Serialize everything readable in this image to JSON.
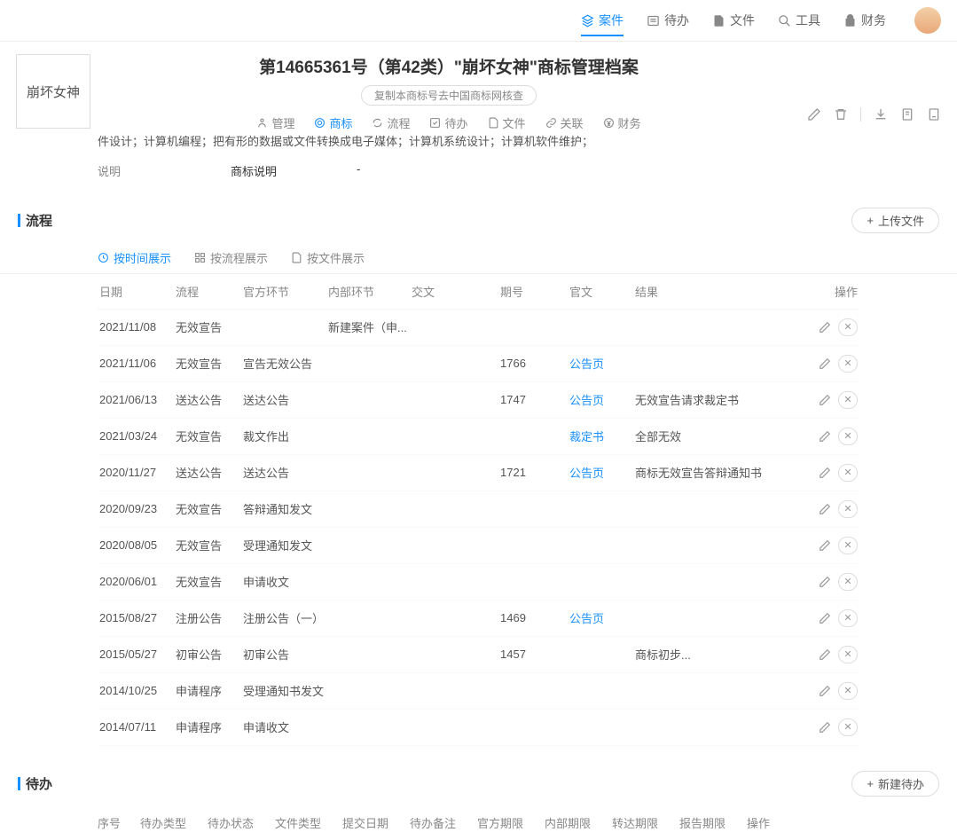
{
  "topnav": {
    "case": "案件",
    "todo": "待办",
    "file": "文件",
    "tool": "工具",
    "finance": "财务"
  },
  "brandText": "崩坏女神",
  "pageTitle": "第14665361号（第42类）\"崩坏女神\"商标管理档案",
  "copyLink": "复制本商标号去中国商标网核查",
  "subnav": {
    "manage": "管理",
    "trademark": "商标",
    "process": "流程",
    "todo": "待办",
    "file": "文件",
    "relation": "关联",
    "finance": "财务"
  },
  "descLine": "件设计；计算机编程；把有形的数据或文件转换成电子媒体；计算机系统设计；计算机软件维护；",
  "descLabel": "说明",
  "descField": "商标说明",
  "descDash": "-",
  "sectionProcess": "流程",
  "uploadBtn": "上传文件",
  "viewtabs": {
    "byTime": "按时间展示",
    "byProcess": "按流程展示",
    "byFile": "按文件展示"
  },
  "cols": {
    "date": "日期",
    "process": "流程",
    "official": "官方环节",
    "internal": "内部环节",
    "exchange": "交文",
    "issue": "期号",
    "officialDoc": "官文",
    "result": "结果",
    "ops": "操作"
  },
  "rows": [
    {
      "date": "2021/11/08",
      "process": "无效宣告",
      "official": "",
      "internal": "新建案件（申...",
      "exchange": "",
      "issue": "",
      "doc": "",
      "result": ""
    },
    {
      "date": "2021/11/06",
      "process": "无效宣告",
      "official": "宣告无效公告",
      "internal": "",
      "exchange": "",
      "issue": "1766",
      "doc": "公告页",
      "result": ""
    },
    {
      "date": "2021/06/13",
      "process": "送达公告",
      "official": "送达公告",
      "internal": "",
      "exchange": "",
      "issue": "1747",
      "doc": "公告页",
      "result": "无效宣告请求裁定书"
    },
    {
      "date": "2021/03/24",
      "process": "无效宣告",
      "official": "裁文作出",
      "internal": "",
      "exchange": "",
      "issue": "",
      "doc": "裁定书",
      "result": "全部无效"
    },
    {
      "date": "2020/11/27",
      "process": "送达公告",
      "official": "送达公告",
      "internal": "",
      "exchange": "",
      "issue": "1721",
      "doc": "公告页",
      "result": "商标无效宣告答辩通知书"
    },
    {
      "date": "2020/09/23",
      "process": "无效宣告",
      "official": "答辩通知发文",
      "internal": "",
      "exchange": "",
      "issue": "",
      "doc": "",
      "result": ""
    },
    {
      "date": "2020/08/05",
      "process": "无效宣告",
      "official": "受理通知发文",
      "internal": "",
      "exchange": "",
      "issue": "",
      "doc": "",
      "result": ""
    },
    {
      "date": "2020/06/01",
      "process": "无效宣告",
      "official": "申请收文",
      "internal": "",
      "exchange": "",
      "issue": "",
      "doc": "",
      "result": ""
    },
    {
      "date": "2015/08/27",
      "process": "注册公告",
      "official": "注册公告（一）",
      "internal": "",
      "exchange": "",
      "issue": "1469",
      "doc": "公告页",
      "result": ""
    },
    {
      "date": "2015/05/27",
      "process": "初审公告",
      "official": "初审公告",
      "internal": "",
      "exchange": "",
      "issue": "1457",
      "doc": "",
      "result": "商标初步..."
    },
    {
      "date": "2014/10/25",
      "process": "申请程序",
      "official": "受理通知书发文",
      "internal": "",
      "exchange": "",
      "issue": "",
      "doc": "",
      "result": ""
    },
    {
      "date": "2014/07/11",
      "process": "申请程序",
      "official": "申请收文",
      "internal": "",
      "exchange": "",
      "issue": "",
      "doc": "",
      "result": ""
    }
  ],
  "sectionTodo": "待办",
  "newTodoBtn": "新建待办",
  "todoCols": {
    "seq": "序号",
    "type": "待办类型",
    "status": "待办状态",
    "fileType": "文件类型",
    "submitDate": "提交日期",
    "note": "待办备注",
    "officialDue": "官方期限",
    "internalDue": "内部期限",
    "forwardDue": "转达期限",
    "reportDue": "报告期限",
    "ops": "操作"
  }
}
